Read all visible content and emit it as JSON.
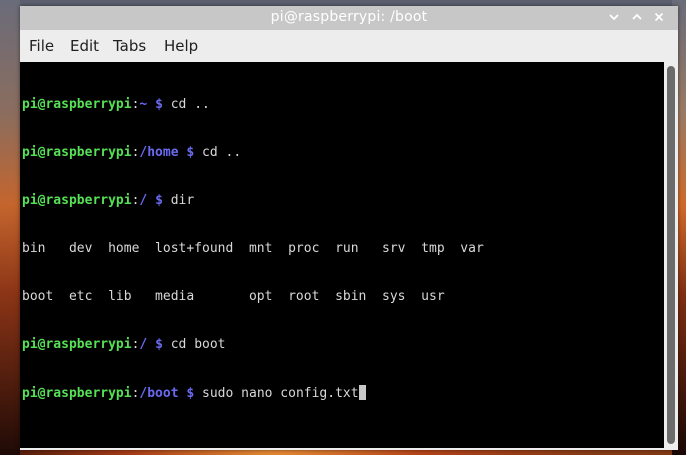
{
  "window": {
    "title": "pi@raspberrypi: /boot",
    "controls": {
      "minimize_icon": "minimize-icon",
      "maximize_icon": "maximize-icon",
      "close_icon": "close-icon"
    }
  },
  "menu": {
    "file": "File",
    "edit": "Edit",
    "tabs": "Tabs",
    "help": "Help"
  },
  "terminal": {
    "colors": {
      "background": "#000000",
      "text": "#d8d8d8",
      "user_host": "#55e055",
      "path": "#6a6af0"
    },
    "lines": [
      {
        "user": "pi@raspberrypi",
        "colon": ":",
        "path": "~",
        "dollar": "$",
        "command": " cd .."
      },
      {
        "user": "pi@raspberrypi",
        "colon": ":",
        "path": "/home",
        "dollar": "$",
        "command": " cd .."
      },
      {
        "user": "pi@raspberrypi",
        "colon": ":",
        "path": "/",
        "dollar": "$",
        "command": " dir"
      },
      {
        "output": "bin   dev  home  lost+found  mnt  proc  run   srv  tmp  var"
      },
      {
        "output": "boot  etc  lib   media       opt  root  sbin  sys  usr"
      },
      {
        "user": "pi@raspberrypi",
        "colon": ":",
        "path": "/",
        "dollar": "$",
        "command": " cd boot"
      },
      {
        "user": "pi@raspberrypi",
        "colon": ":",
        "path": "/boot",
        "dollar": "$",
        "command": " sudo nano config.txt"
      }
    ]
  }
}
